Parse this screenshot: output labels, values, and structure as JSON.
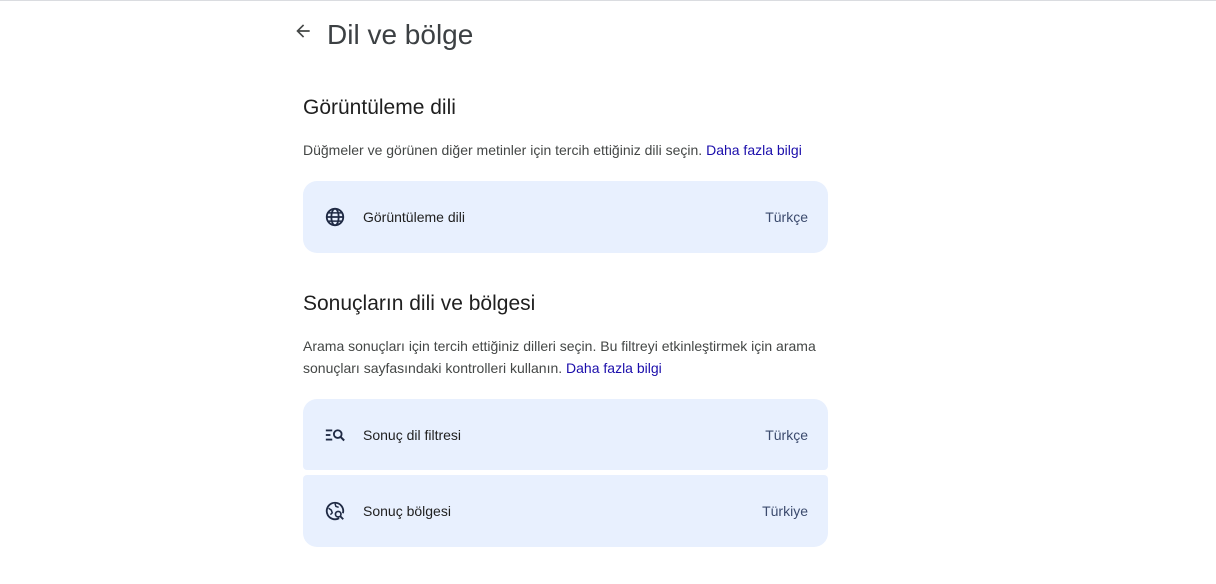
{
  "header": {
    "title": "Dil ve bölge"
  },
  "display_language": {
    "title": "Görüntüleme dili",
    "description": "Düğmeler ve görünen diğer metinler için tercih ettiğiniz dili seçin.",
    "learn_more": "Daha fazla bilgi",
    "setting": {
      "icon": "globe-icon",
      "label": "Görüntüleme dili",
      "value": "Türkçe"
    }
  },
  "results_language": {
    "title": "Sonuçların dili ve bölgesi",
    "description": "Arama sonuçları için tercih ettiğiniz dilleri seçin. Bu filtreyi etkinleştirmek için arama sonuçları sayfasındaki kontrolleri kullanın.",
    "learn_more": "Daha fazla bilgi",
    "settings": [
      {
        "icon": "filter-search-icon",
        "label": "Sonuç dil filtresi",
        "value": "Türkçe"
      },
      {
        "icon": "region-search-icon",
        "label": "Sonuç bölgesi",
        "value": "Türkiye"
      }
    ]
  },
  "colors": {
    "card_background": "#e8f0fe",
    "link": "#1a0dab"
  }
}
